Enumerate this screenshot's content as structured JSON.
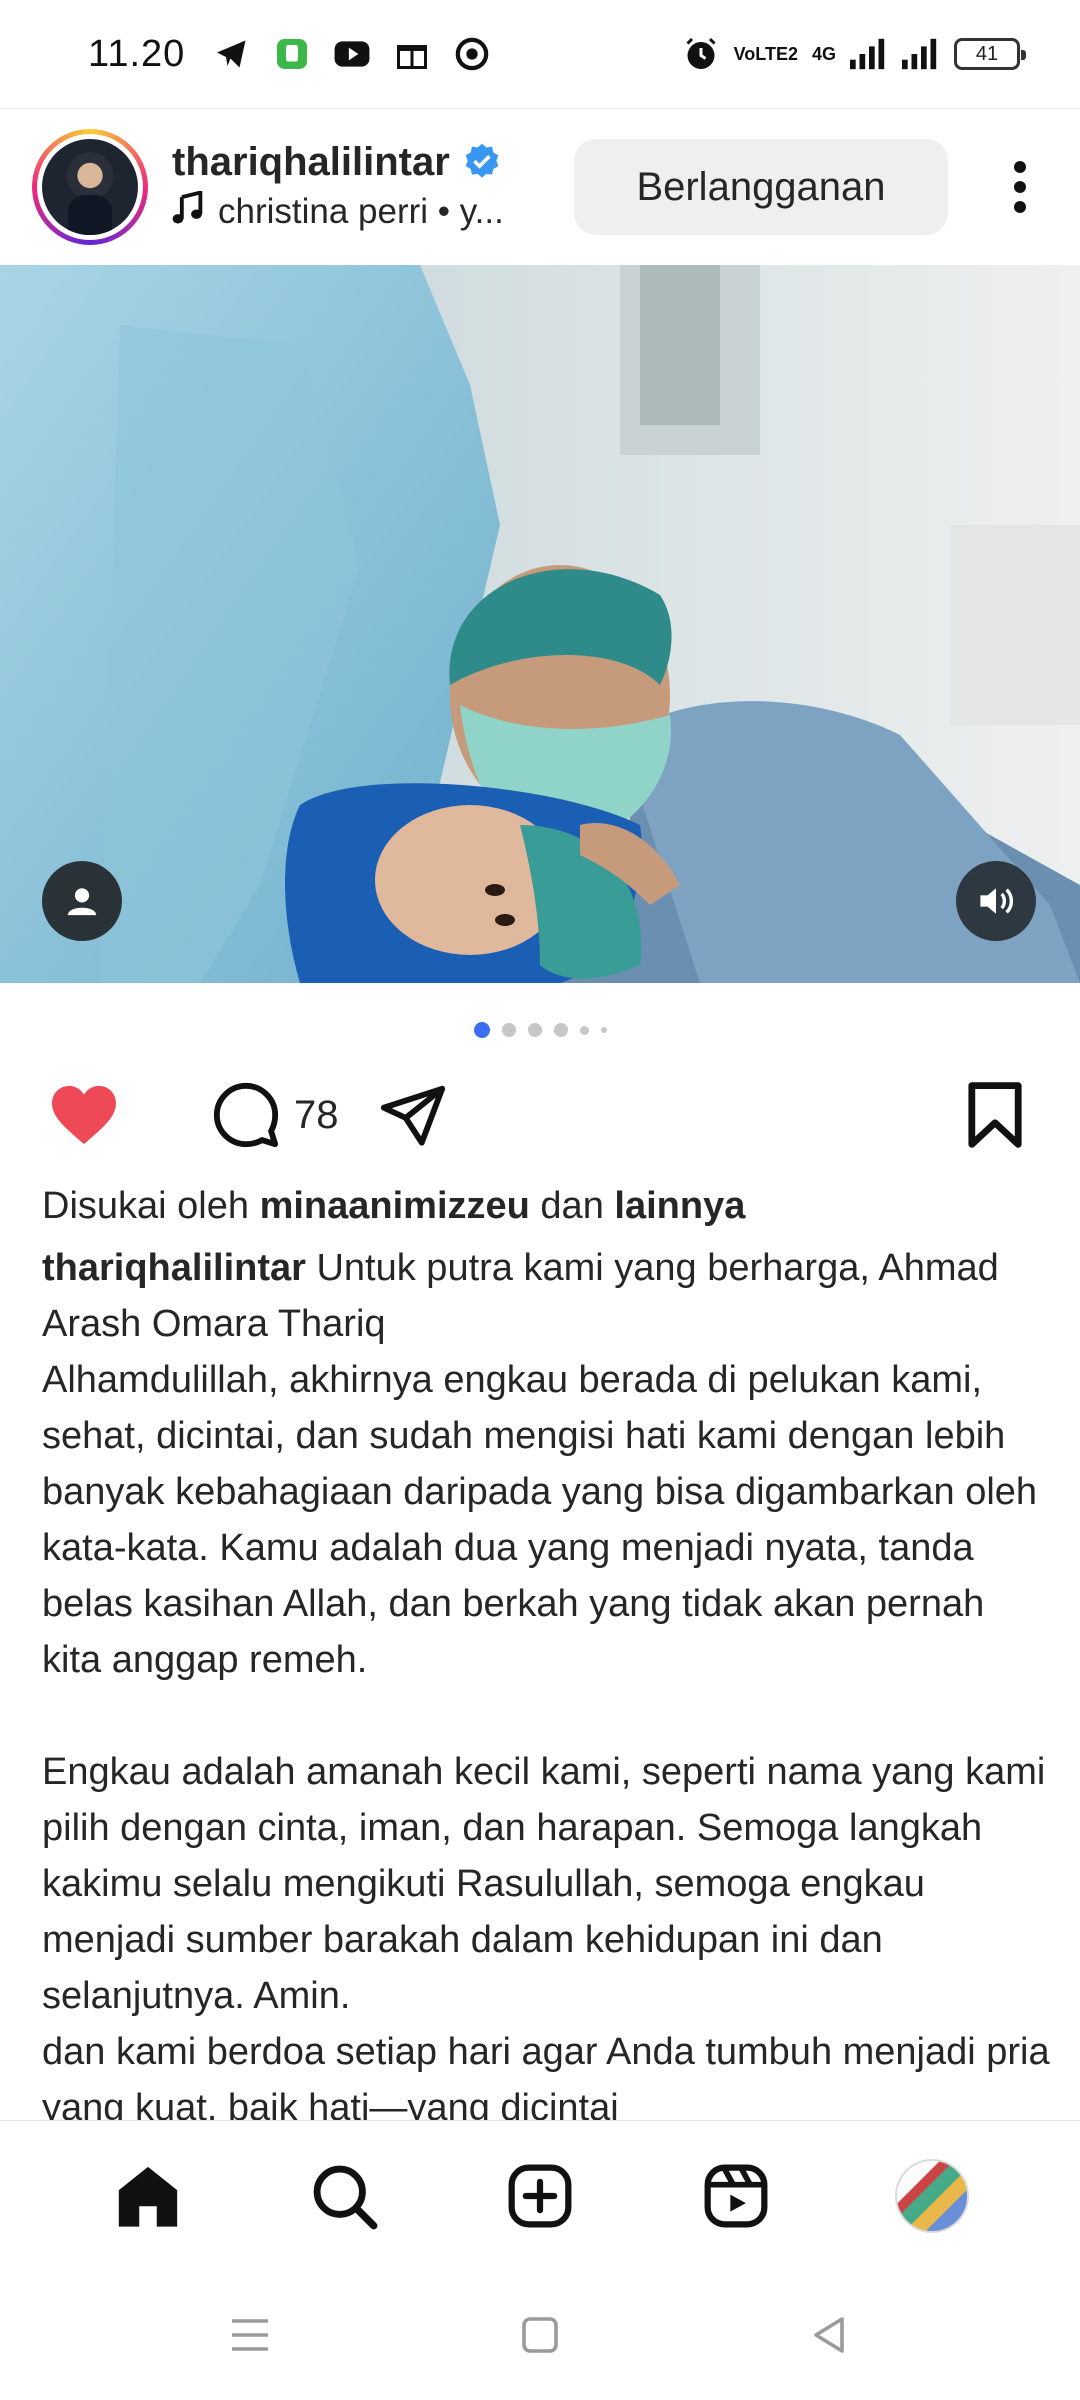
{
  "status_bar": {
    "time": "11.20",
    "network_labels": [
      "VoLTE2",
      "4G"
    ],
    "battery": "41",
    "icons": [
      "telegram-icon",
      "app-icon",
      "youtube-icon",
      "gift-icon",
      "chrome-icon",
      "alarm-icon",
      "signal-icon",
      "signal-icon"
    ]
  },
  "header": {
    "username": "thariqhalilintar",
    "music": "christina perri • y...",
    "subscribe_label": "Berlangganan",
    "icons": [
      "verified-icon",
      "music-note-icon",
      "more-icon"
    ]
  },
  "carousel": {
    "dot_count": 6,
    "active_index": 0,
    "icons": [
      "user-tag-icon",
      "sound-icon"
    ]
  },
  "actions": {
    "comment_count": "78",
    "like_color": "#ed4956",
    "icons": [
      "heart-icon",
      "comment-icon",
      "share-icon",
      "bookmark-icon"
    ]
  },
  "likes": {
    "prefix": "Disukai oleh",
    "user": "minaanimizzeu",
    "connector": "dan",
    "others": "lainnya"
  },
  "caption": {
    "user": "thariqhalilintar",
    "paragraph1": "Untuk putra kami yang berharga, Ahmad Arash Omara Thariq",
    "paragraph2": "Alhamdulillah, akhirnya engkau berada di pelukan kami, sehat, dicintai, dan sudah mengisi hati kami dengan lebih banyak kebahagiaan daripada yang bisa digambarkan oleh kata-kata. Kamu adalah dua yang menjadi nyata, tanda belas kasihan Allah, dan berkah yang tidak akan pernah kita anggap remeh.",
    "paragraph3": "Engkau adalah amanah kecil kami, seperti nama yang kami pilih dengan cinta, iman, dan harapan. Semoga langkah kakimu selalu mengikuti Rasulullah, semoga engkau menjadi sumber barakah dalam kehidupan ini dan selanjutnya. Amin.",
    "paragraph4": "dan kami berdoa setiap hari agar Anda tumbuh menjadi pria yang kuat, baik hati—yang dicintai"
  },
  "bottom_nav": {
    "items": [
      "home-icon",
      "search-icon",
      "create-icon",
      "reels-icon",
      "profile-avatar"
    ]
  },
  "system_nav": {
    "items": [
      "menu-icon",
      "home-square-icon",
      "back-icon"
    ]
  }
}
